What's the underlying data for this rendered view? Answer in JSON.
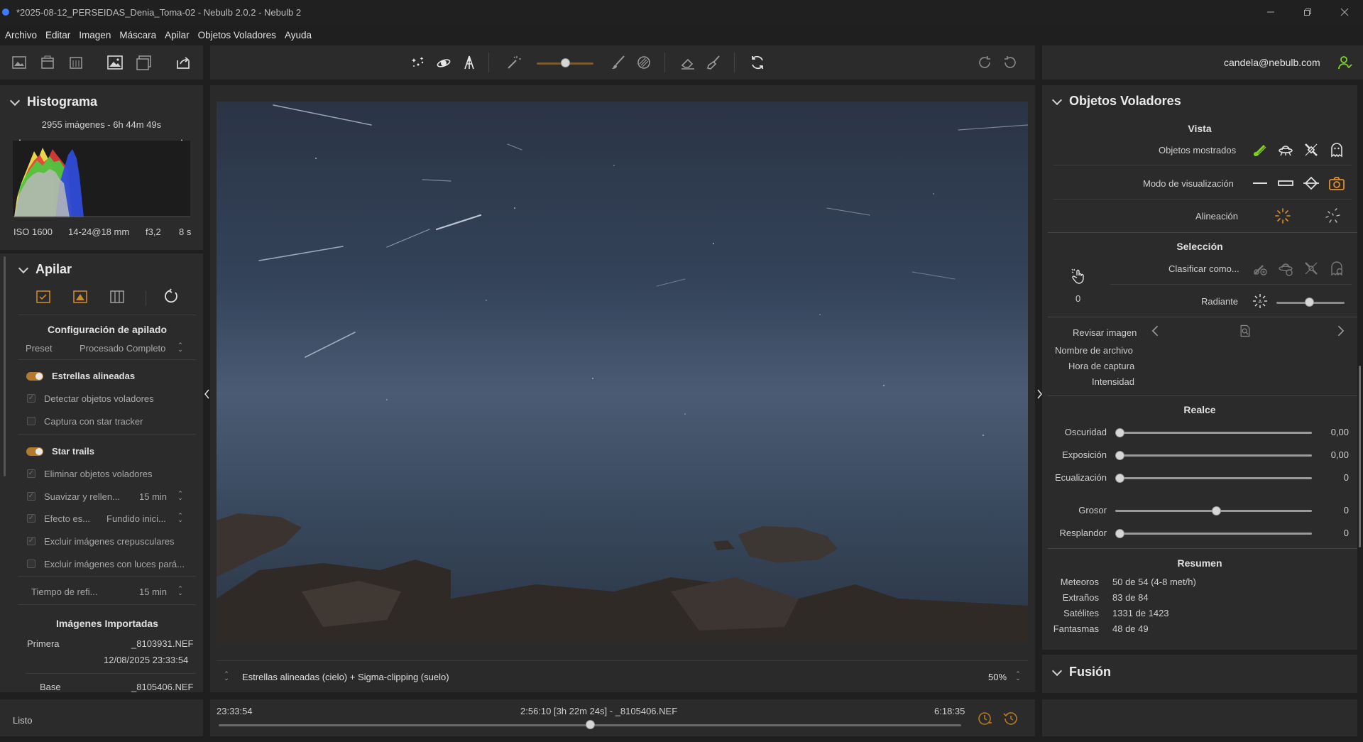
{
  "window": {
    "title": "*2025-08-12_PERSEIDAS_Denia_Toma-02 - Nebulb 2.0.2 - Nebulb 2",
    "controls": [
      "minimize",
      "restore",
      "close"
    ]
  },
  "menu": [
    "Archivo",
    "Editar",
    "Imagen",
    "Máscara",
    "Apilar",
    "Objetos Voladores",
    "Ayuda"
  ],
  "toolbar": {
    "left_icons": [
      "open-images-icon",
      "open-folder-icon",
      "calendar-icon",
      "image-icon",
      "image-stack-icon",
      "export-icon"
    ],
    "center_icons": [
      "stars-icon",
      "comet-icon",
      "tower-icon",
      "magic-wand-icon",
      "brush-icon",
      "brush-eraser-icon",
      "eraser-icon",
      "broom-icon",
      "refresh-icon"
    ],
    "brush_size": 0.4,
    "right_icons": [
      "redo-icon",
      "undo-icon"
    ],
    "user": "candela@nebulb.com"
  },
  "histogram": {
    "title": "Histograma",
    "summary": "2955 imágenes - 6h 44m 49s",
    "iso": "ISO 1600",
    "lens": "14-24@18 mm",
    "aperture": "f3,2",
    "exposure": "8 s"
  },
  "stack": {
    "title": "Apilar",
    "config_title": "Configuración de apilado",
    "preset_label": "Preset",
    "preset_value": "Procesado Completo",
    "options": [
      {
        "label": "Estrellas alineadas",
        "type": "toggle"
      },
      {
        "label": "Detectar objetos voladores",
        "type": "check",
        "checked": true
      },
      {
        "label": "Captura con star tracker",
        "type": "check",
        "checked": false
      },
      {
        "label": "Star trails",
        "type": "toggle"
      },
      {
        "label": "Eliminar objetos voladores",
        "type": "check",
        "checked": true
      },
      {
        "label": "Suavizar y rellen...",
        "type": "check",
        "checked": true,
        "value": "15 min"
      },
      {
        "label": "Efecto es...",
        "type": "check",
        "checked": true,
        "value": "Fundido inici..."
      },
      {
        "label": "Excluir imágenes crepusculares",
        "type": "check",
        "checked": true
      },
      {
        "label": "Excluir imágenes con luces pará...",
        "type": "check",
        "checked": false
      }
    ],
    "refresh_label": "Tiempo de refi...",
    "refresh_value": "15 min",
    "imported_title": "Imágenes Importadas",
    "first_label": "Primera",
    "first_file": "_8103931.NEF",
    "first_date": "12/08/2025 23:33:54",
    "base_label": "Base",
    "base_file": "_8105406.NEF"
  },
  "status": {
    "text": "Listo"
  },
  "viewer": {
    "mode": "Estrellas alineadas (cielo) + Sigma-clipping (suelo)",
    "zoom": "50%"
  },
  "timeline": {
    "start": "23:33:54",
    "current": "2:56:10 [3h 22m 24s] - _8105406.NEF",
    "end": "6:18:35",
    "position": 0.5
  },
  "flying": {
    "title": "Objetos Voladores",
    "vista_title": "Vista",
    "shown_label": "Objetos mostrados",
    "viz_label": "Modo de visualización",
    "align_label": "Alineación",
    "selection_title": "Selección",
    "classify_label": "Clasificar como...",
    "count": "0",
    "radiant_label": "Radiante",
    "review_label": "Revisar imagen",
    "filename_label": "Nombre de archivo",
    "capture_label": "Hora de captura",
    "intensity_label": "Intensidad",
    "enhance_title": "Realce",
    "sliders": [
      {
        "label": "Oscuridad",
        "value": "0,00",
        "level": 0
      },
      {
        "label": "Exposición",
        "value": "0,00",
        "level": 0
      },
      {
        "label": "Ecualización",
        "value": "0",
        "level": 0
      },
      {
        "label": "Grosor",
        "value": "0",
        "level": 0.5
      },
      {
        "label": "Resplandor",
        "value": "0",
        "level": 0
      }
    ],
    "summary_title": "Resumen",
    "summary": [
      {
        "label": "Meteoros",
        "value": "50 de 54 (4-8 met/h)"
      },
      {
        "label": "Extraños",
        "value": "83 de 84"
      },
      {
        "label": "Satélites",
        "value": "1331 de 1423"
      },
      {
        "label": "Fantasmas",
        "value": "48 de 49"
      }
    ],
    "fusion_title": "Fusión"
  },
  "colors": {
    "accent": "#e0902a",
    "green": "#7ed321",
    "panel": "#2b2b2b",
    "background": "#1f1f1f"
  }
}
